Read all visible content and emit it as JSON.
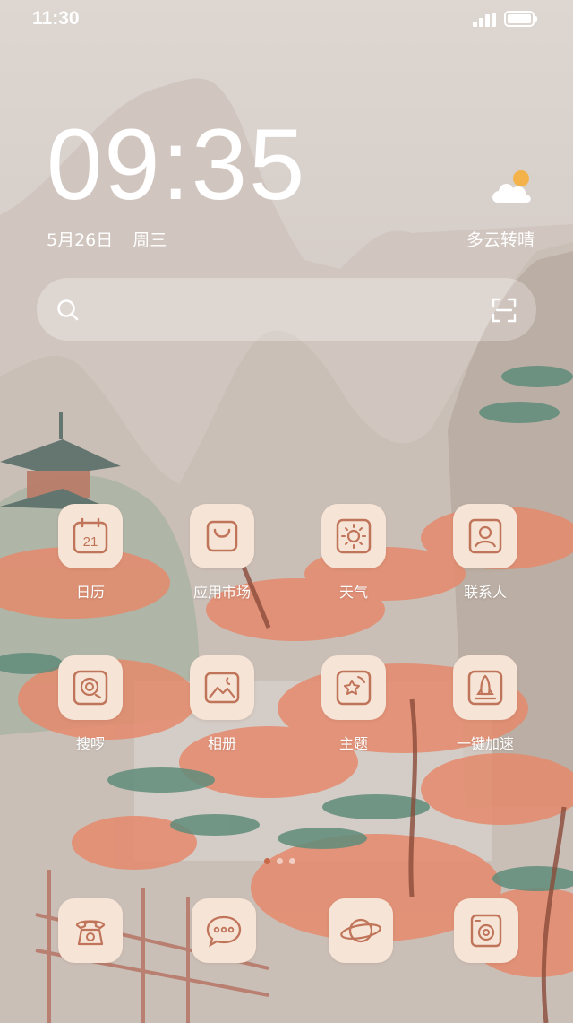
{
  "status_bar": {
    "time": "11:30"
  },
  "clock": {
    "time": "09:35"
  },
  "date": {
    "date": "5月26日",
    "weekday": "周三"
  },
  "weather": {
    "text": "多云转晴",
    "icon": "partly-cloudy-icon"
  },
  "search": {
    "icon": "search-icon",
    "scan_icon": "scan-icon"
  },
  "apps": [
    {
      "label": "日历",
      "icon": "calendar-icon",
      "badge": "21"
    },
    {
      "label": "应用市场",
      "icon": "shopping-bag-icon"
    },
    {
      "label": "天气",
      "icon": "sun-icon"
    },
    {
      "label": "联系人",
      "icon": "contact-icon"
    },
    {
      "label": "搜啰",
      "icon": "search-app-icon"
    },
    {
      "label": "相册",
      "icon": "photo-icon"
    },
    {
      "label": "主题",
      "icon": "theme-icon"
    },
    {
      "label": "一键加速",
      "icon": "rocket-icon"
    }
  ],
  "page_indicator": {
    "pages": 3,
    "active": 1
  },
  "dock": [
    {
      "icon": "phone-icon"
    },
    {
      "icon": "message-icon"
    },
    {
      "icon": "browser-planet-icon"
    },
    {
      "icon": "camera-icon"
    }
  ],
  "colors": {
    "icon_stroke": "#c0745a",
    "tile_bg": "#f6e4d6",
    "active_dot": "#c86a47"
  }
}
